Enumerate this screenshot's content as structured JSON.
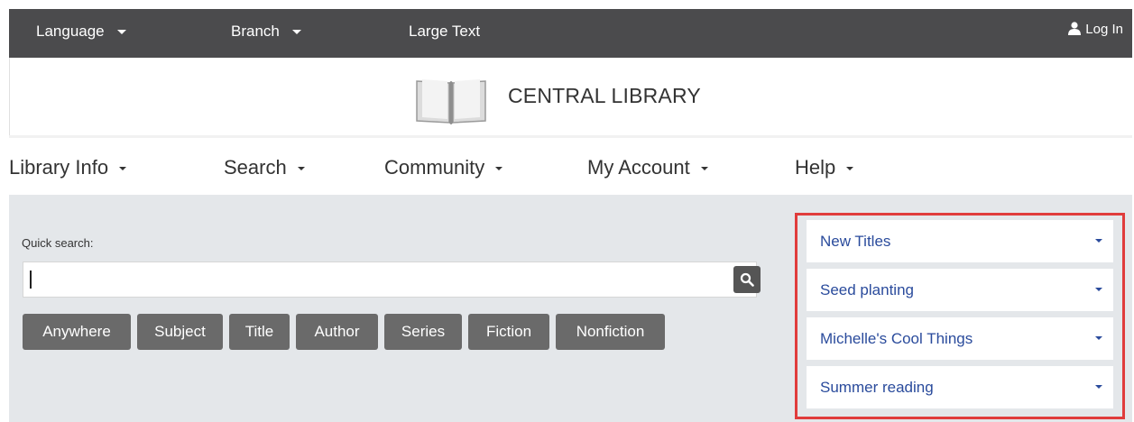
{
  "topbar": {
    "language": "Language",
    "branch": "Branch",
    "large_text": "Large Text",
    "login": "Log In"
  },
  "header": {
    "library_name": "CENTRAL LIBRARY"
  },
  "nav": {
    "items": [
      {
        "label": "Library Info"
      },
      {
        "label": "Search"
      },
      {
        "label": "Community"
      },
      {
        "label": "My Account"
      },
      {
        "label": "Help"
      }
    ]
  },
  "search": {
    "label": "Quick search:",
    "value": ""
  },
  "filters": [
    "Anywhere",
    "Subject",
    "Title",
    "Author",
    "Series",
    "Fiction",
    "Nonfiction"
  ],
  "panel": {
    "items": [
      {
        "label": "New Titles"
      },
      {
        "label": "Seed planting"
      },
      {
        "label": "Michelle's Cool Things"
      },
      {
        "label": "Summer reading"
      }
    ]
  },
  "colors": {
    "topbar_bg": "#4b4b4d",
    "main_bg": "#e4e7ea",
    "filter_bg": "#6a6a6a",
    "link_blue": "#2a4b9c",
    "highlight_border": "#e03c3c"
  },
  "icons": {
    "user": "user-icon",
    "search": "search-icon",
    "logo": "open-book-icon"
  }
}
